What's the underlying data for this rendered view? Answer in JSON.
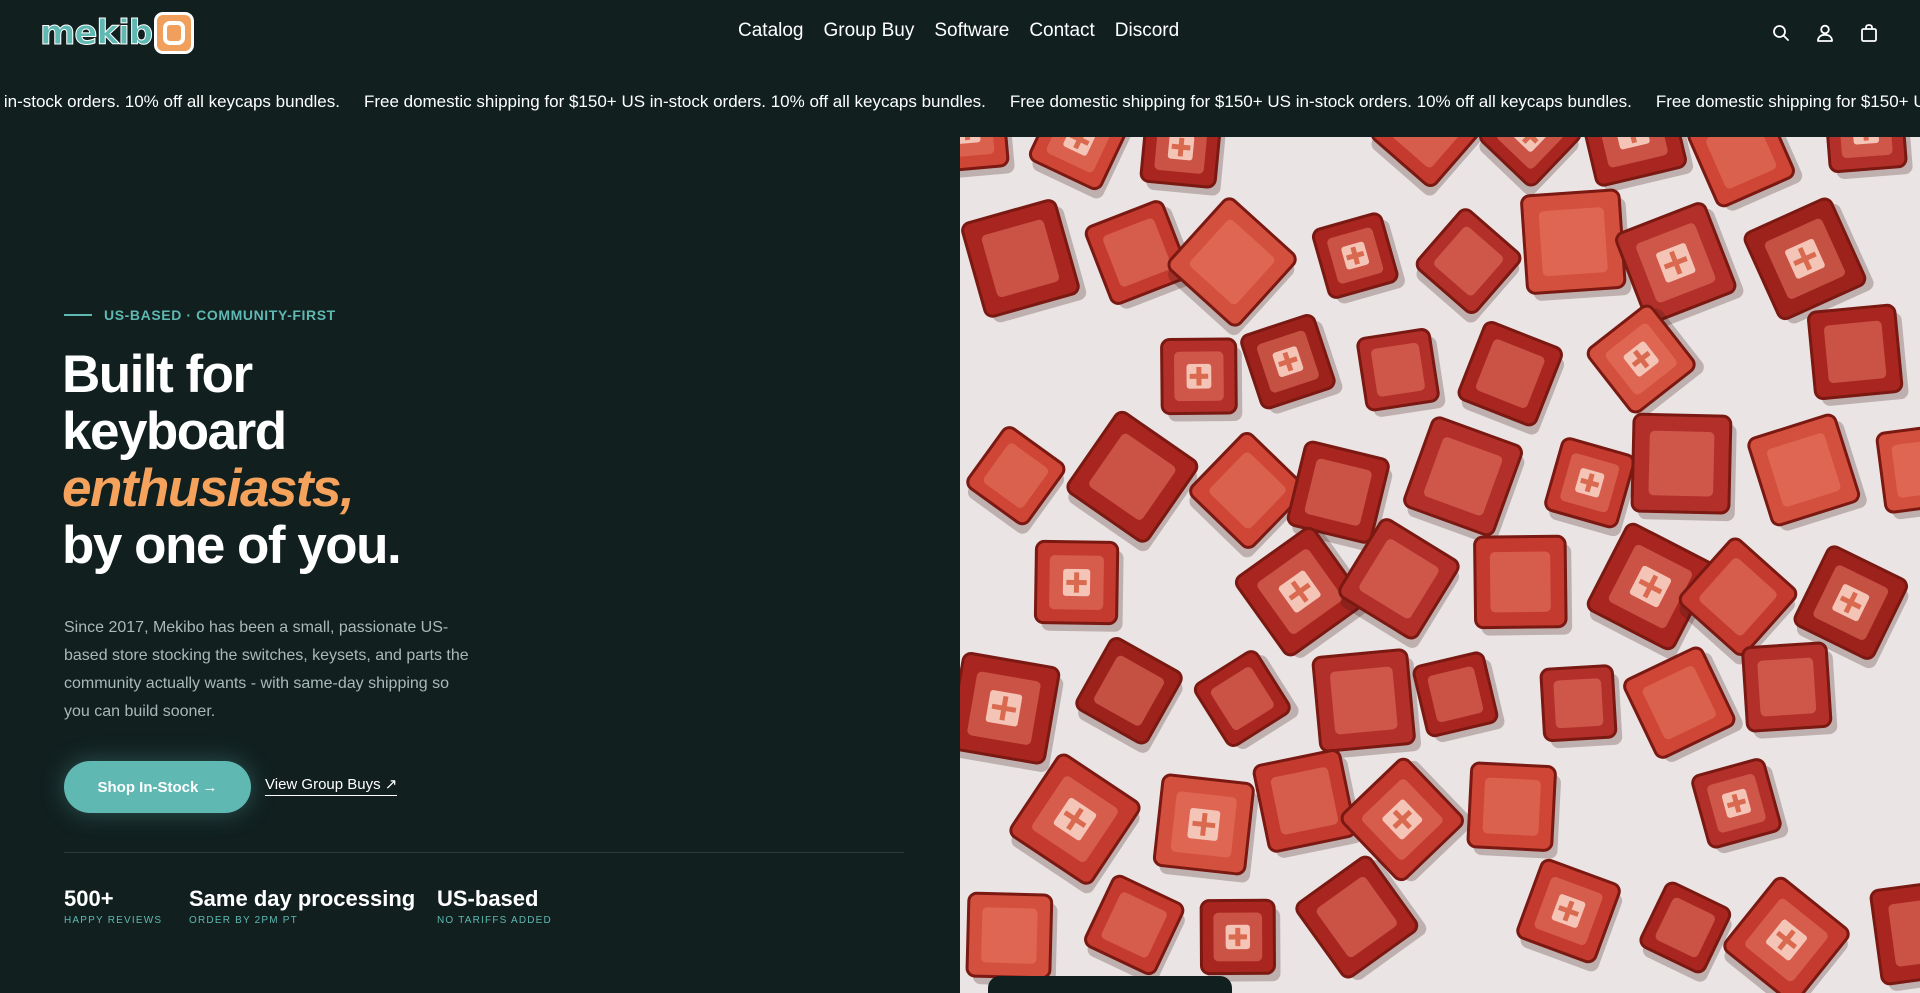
{
  "header": {
    "logo_alt": "mekibo",
    "nav": [
      "Catalog",
      "Group Buy",
      "Software",
      "Contact",
      "Discord"
    ],
    "icons": [
      "search-icon",
      "account-icon",
      "cart-icon"
    ]
  },
  "announcement": {
    "text": "Free domestic shipping for $150+ US in-stock orders. 10% off all keycaps bundles."
  },
  "hero": {
    "eyebrow": "US-BASED · COMMUNITY-FIRST",
    "headline_line1": "Built for",
    "headline_line2": "keyboard",
    "headline_accent": "enthusiasts,",
    "headline_line4": "by one of you.",
    "description": "Since 2017, Mekibo has been a small, passionate US-based store stocking the switches, keysets, and parts the community actually wants - with same-day shipping so you can build sooner.",
    "primary_cta": "Shop In-Stock →",
    "secondary_cta": "View Group Buys ↗",
    "stats": [
      {
        "value": "500+",
        "label": "HAPPY REVIEWS"
      },
      {
        "value": "Same day processing",
        "label": "ORDER BY 2PM PT"
      },
      {
        "value": "US-based",
        "label": "NO TARIFFS ADDED"
      }
    ]
  },
  "colors": {
    "background": "#111f1f",
    "teal": "#5fb8b2",
    "accent_orange": "#f5a25d"
  }
}
